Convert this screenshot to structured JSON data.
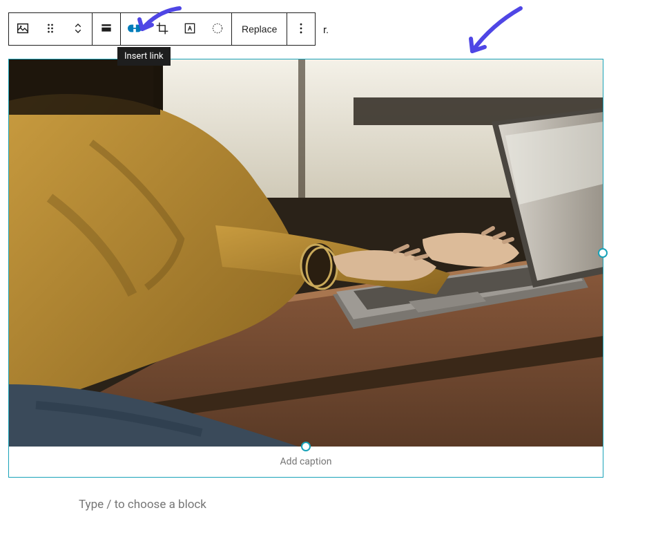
{
  "toolbar": {
    "image_block_icon": "image-icon",
    "drag_icon": "drag-handle-icon",
    "move_icon": "move-up-down-icon",
    "align_icon": "align-icon",
    "link_icon": "link-icon",
    "crop_icon": "crop-icon",
    "text_icon": "text-overlay-icon",
    "duotone_icon": "duotone-icon",
    "replace_label": "Replace",
    "more_icon": "more-options-icon"
  },
  "tooltip": {
    "insert_link": "Insert link"
  },
  "behind_fragment": "r.",
  "caption_placeholder": "Add caption",
  "appender_placeholder": "Type / to choose a block",
  "colors": {
    "selection": "#17a2b8",
    "active": "#007cba",
    "arrow": "#4f46e5"
  }
}
